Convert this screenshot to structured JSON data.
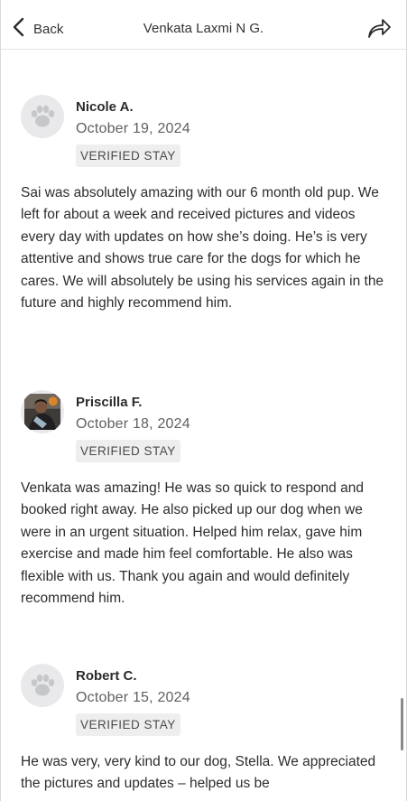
{
  "header": {
    "back_label": "Back",
    "title": "Venkata Laxmi N G."
  },
  "icons": {
    "back": "chevron-left-icon",
    "share": "share-arrow-icon",
    "default_avatar": "paw-icon"
  },
  "reviews": [
    {
      "name": "Nicole A.",
      "date": "October 19, 2024",
      "badge": "VERIFIED STAY",
      "text": "Sai was absolutely amazing with our 6 month old pup. We left for about a week and received pictures and videos every day with updates on how she’s doing. He’s is very attentive and shows true care for the dogs for which he cares.  We will absolutely be using his services again in the future and highly recommend him."
    },
    {
      "name": "Priscilla F.",
      "date": "October 18, 2024",
      "badge": "VERIFIED STAY",
      "text": "Venkata was amazing! He was so quick to respond and booked right away. He also picked up our dog when we were in an urgent situation. Helped him relax, gave him exercise and made him feel comfortable. He also was flexible with us. Thank you again and would definitely recommend him."
    },
    {
      "name": "Robert C.",
      "date": "October 15, 2024",
      "badge": "VERIFIED STAY",
      "text": "He was very, very kind to our dog, Stella. We appreciated the pictures and updates – helped us be"
    }
  ]
}
